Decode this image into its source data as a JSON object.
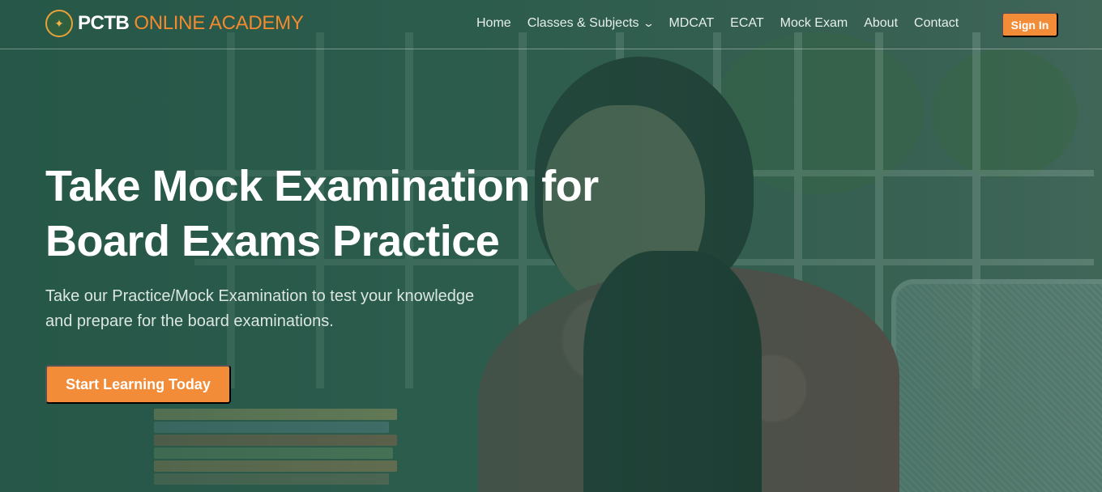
{
  "brand": {
    "logo_icon": "academy-crest-icon",
    "name_strong": "PCTB",
    "name_light": "ONLINE ACADEMY"
  },
  "nav": {
    "items": [
      {
        "label": "Home"
      },
      {
        "label": "Classes & Subjects",
        "has_dropdown": true,
        "icon": "chevron-down-icon"
      },
      {
        "label": "MDCAT"
      },
      {
        "label": "ECAT"
      },
      {
        "label": "Mock Exam"
      },
      {
        "label": "About"
      },
      {
        "label": "Contact"
      }
    ],
    "signin_label": "Sign In"
  },
  "hero": {
    "title_line1": "Take Mock Examination for",
    "title_line2": "Board Exams Practice",
    "subtitle_line1": "Take our Practice/Mock Examination to test your knowledge",
    "subtitle_line2": "and prepare for the board examinations.",
    "cta_label": "Start Learning Today"
  },
  "colors": {
    "accent": "#f28c38",
    "overlay": "#245646",
    "brand_light": "#f38a2f"
  }
}
